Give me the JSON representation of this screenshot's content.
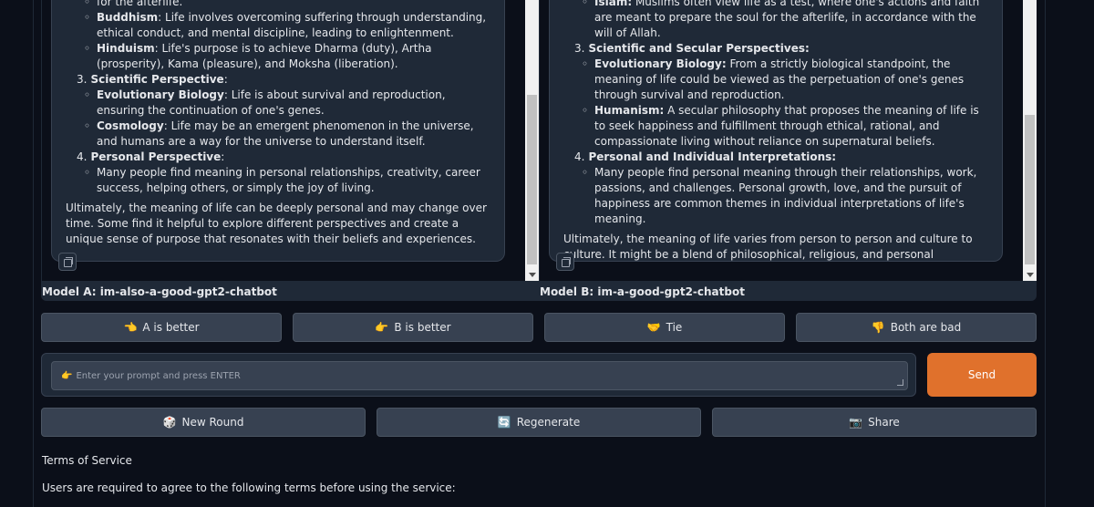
{
  "model_a": {
    "label": "Model A: im-also-a-good-gpt2-chatbot",
    "lines": {
      "top_cut": "for the afterlife.",
      "buddhism_term": "Buddhism",
      "buddhism_text": ": Life involves overcoming suffering through understanding, ethical conduct, and mental discipline, leading to enlightenment.",
      "hinduism_term": "Hinduism",
      "hinduism_text": ": Life's purpose is to achieve Dharma (duty), Artha (prosperity), Kama (pleasure), and Moksha (liberation).",
      "sec3_num": "3.",
      "sec3_title": "Scientific Perspective",
      "sec3_colon": ":",
      "evo_term": "Evolutionary Biology",
      "evo_text": ": Life is about survival and reproduction, ensuring the continuation of one's genes.",
      "cosmo_term": "Cosmology",
      "cosmo_text": ": Life may be an emergent phenomenon in the universe, and humans are a way for the universe to understand itself.",
      "sec4_num": "4.",
      "sec4_title": "Personal Perspective",
      "sec4_colon": ":",
      "personal_text": "Many people find meaning in personal relationships, creativity, career success, helping others, or simply the joy of living.",
      "conclusion": "Ultimately, the meaning of life can be deeply personal and may change over time. Some find it helpful to explore different perspectives and create a unique sense of purpose that resonates with their beliefs and experiences."
    }
  },
  "model_b": {
    "label": "Model B: im-a-good-gpt2-chatbot",
    "lines": {
      "islam_term": "Islam:",
      "islam_text": " Muslims often view life as a test, where one's actions and faith are meant to prepare the soul for the afterlife, in accordance with the will of Allah.",
      "sec3_num": "3.",
      "sec3_title": "Scientific and Secular Perspectives:",
      "evo_term": "Evolutionary Biology:",
      "evo_text": " From a strictly biological standpoint, the meaning of life could be viewed as the perpetuation of one's genes through survival and reproduction.",
      "hum_term": "Humanism:",
      "hum_text": " A secular philosophy that proposes the meaning of life is to seek happiness and fulfillment through ethical, rational, and compassionate living without reliance on supernatural beliefs.",
      "sec4_num": "4.",
      "sec4_title": "Personal and Individual Interpretations:",
      "personal_text": "Many people find personal meaning through their relationships, work, passions, and challenges. Personal growth, love, and the pursuit of happiness are common themes in individual interpretations of life's meaning.",
      "conclusion": "Ultimately, the meaning of life varies from person to person and culture to culture. It might be a blend of philosophical, religious, and personal elements, or a simple commitment to living one's life fully and responsibly."
    }
  },
  "vote": {
    "a_better": {
      "icon": "👈",
      "label": "A is better"
    },
    "b_better": {
      "icon": "👉",
      "label": "B is better"
    },
    "tie": {
      "icon": "🤝",
      "label": "Tie"
    },
    "both_bad": {
      "icon": "👎",
      "label": "Both are bad"
    }
  },
  "prompt": {
    "icon": "👉",
    "placeholder": "Enter your prompt and press ENTER",
    "send_label": "Send"
  },
  "actions": {
    "new_round": {
      "icon": "🎲",
      "label": "New Round"
    },
    "regenerate": {
      "icon": "🔄",
      "label": "Regenerate"
    },
    "share": {
      "icon": "📷",
      "label": "Share"
    }
  },
  "tos": {
    "title": "Terms of Service",
    "text": "Users are required to agree to the following terms before using the service:"
  },
  "colors": {
    "background": "#0b0f19",
    "panel": "#1f2937",
    "button": "#374151",
    "send": "#e0712c"
  }
}
